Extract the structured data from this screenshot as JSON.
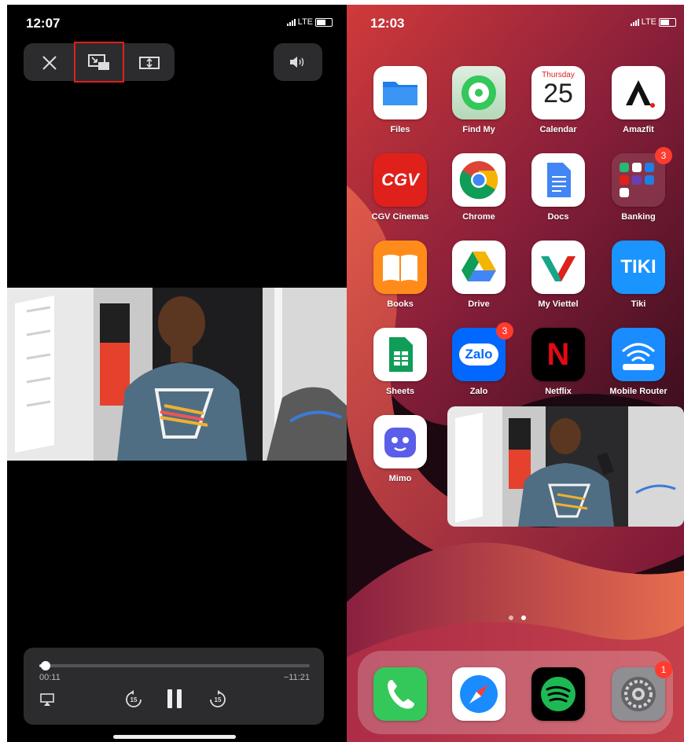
{
  "left": {
    "status": {
      "time": "12:07",
      "network": "LTE"
    },
    "player": {
      "elapsed": "00:11",
      "remaining": "−11:21",
      "progress_fraction": 0.022,
      "skip_back_label": "15",
      "skip_forward_label": "15"
    }
  },
  "right": {
    "status": {
      "time": "12:03",
      "network": "LTE"
    },
    "calendar": {
      "weekday": "Thursday",
      "day": "25"
    },
    "apps": [
      {
        "label": "Files"
      },
      {
        "label": "Find My"
      },
      {
        "label": "Calendar"
      },
      {
        "label": "Amazfit"
      },
      {
        "label": "CGV Cinemas",
        "text": "CGV"
      },
      {
        "label": "Chrome"
      },
      {
        "label": "Docs"
      },
      {
        "label": "Banking",
        "badge": "3"
      },
      {
        "label": "Books"
      },
      {
        "label": "Drive"
      },
      {
        "label": "My Viettel"
      },
      {
        "label": "Tiki",
        "text": "TIKI"
      },
      {
        "label": "Sheets"
      },
      {
        "label": "Zalo",
        "badge": "3",
        "text": "Zalo"
      },
      {
        "label": "Netflix",
        "text": "N"
      },
      {
        "label": "Mobile Router"
      },
      {
        "label": "Mimo"
      }
    ],
    "dock": {
      "settings_badge": "1"
    },
    "page_dots": 2,
    "colors": {
      "badge": "#ff3b30",
      "highlight": "#e0201b"
    }
  }
}
